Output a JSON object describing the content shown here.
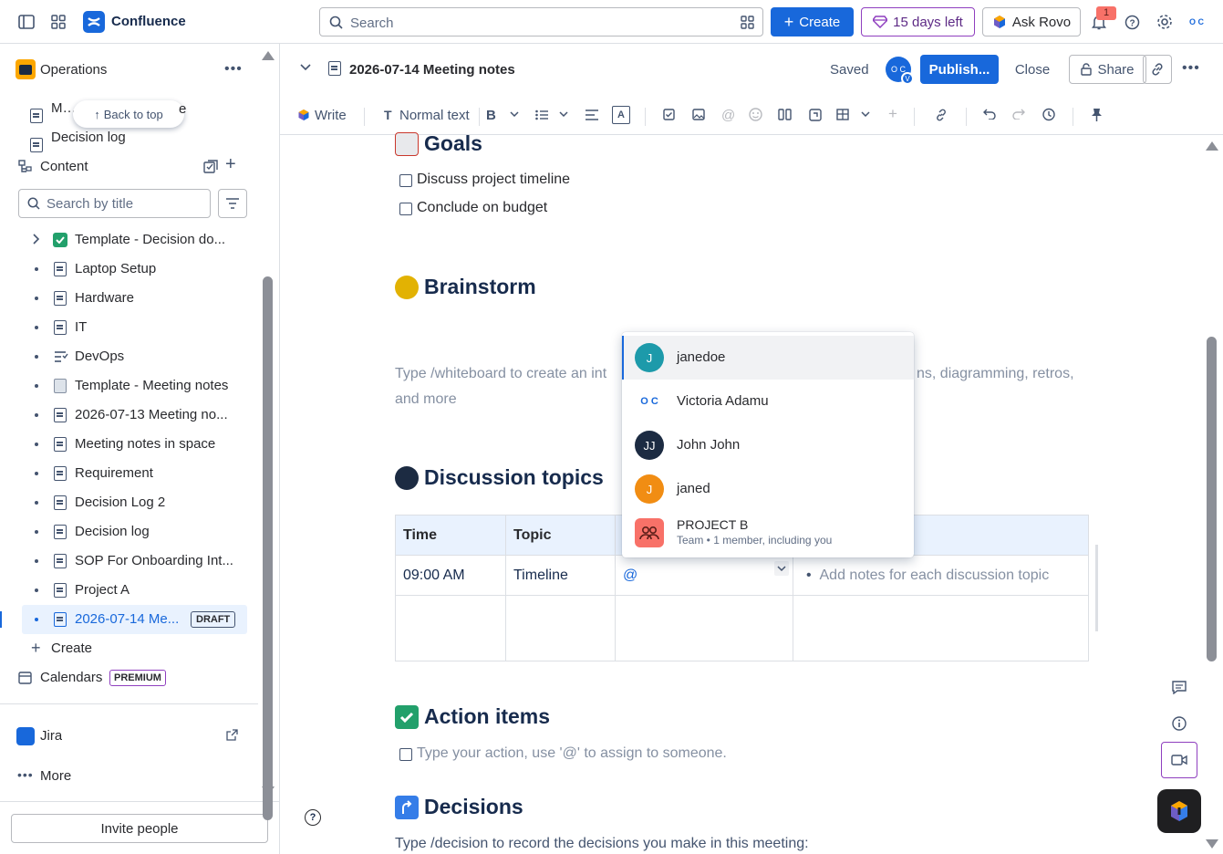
{
  "topbar": {
    "app_name": "Confluence",
    "search_placeholder": "Search",
    "create_label": "Create",
    "trial_label": "15 days left",
    "rovo_label": "Ask Rovo",
    "notification_count": "1",
    "avatar_text": "O C"
  },
  "sidebar": {
    "space_name": "Operations",
    "pinned": [
      "Meeting notes",
      "Decision log"
    ],
    "back_to_top": "Back to top",
    "content_label": "Content",
    "search_placeholder": "Search by title",
    "tree": [
      {
        "label": "Template - Decision do...",
        "icon": "check-emoji"
      },
      {
        "label": "Laptop Setup",
        "icon": "page"
      },
      {
        "label": "Hardware",
        "icon": "page"
      },
      {
        "label": "IT",
        "icon": "page"
      },
      {
        "label": "DevOps",
        "icon": "list"
      },
      {
        "label": "Template - Meeting notes",
        "icon": "notepad-emoji"
      },
      {
        "label": "2026-07-13 Meeting no...",
        "icon": "page"
      },
      {
        "label": "Meeting notes in space",
        "icon": "page"
      },
      {
        "label": "Requirement",
        "icon": "page"
      },
      {
        "label": "Decision Log 2",
        "icon": "page"
      },
      {
        "label": "Decision log",
        "icon": "page"
      },
      {
        "label": "SOP For Onboarding Int...",
        "icon": "page"
      },
      {
        "label": "Project A",
        "icon": "page"
      }
    ],
    "active_item": {
      "label": "2026-07-14 Me...",
      "badge": "DRAFT"
    },
    "create_label": "Create",
    "calendars_label": "Calendars",
    "premium_badge": "PREMIUM",
    "jira_label": "Jira",
    "more_label": "More",
    "invite_label": "Invite people"
  },
  "editor": {
    "page_title": "2026-07-14 Meeting notes",
    "saved_label": "Saved",
    "publish_label": "Publish...",
    "close_label": "Close",
    "share_label": "Share",
    "toolbar": {
      "write_label": "Write",
      "text_style": "Normal text"
    }
  },
  "doc": {
    "goals_heading": "Goals",
    "goals": [
      "Discuss project timeline",
      "Conclude on budget"
    ],
    "brainstorm_heading": "Brainstorm",
    "whiteboard_line1": "Type /whiteboard to create an int",
    "whiteboard_line1_end": "ns, diagramming, retros,",
    "whiteboard_line2": "and more",
    "discussion_heading": "Discussion topics",
    "table": {
      "headers": [
        "Time",
        "Topic"
      ],
      "row": {
        "time": "09:00 AM",
        "topic": "Timeline",
        "mention": "@",
        "notes_placeholder": "Add notes for each discussion topic"
      }
    },
    "action_heading": "Action items",
    "action_placeholder": "Type your action, use '@' to assign to someone.",
    "decisions_heading": "Decisions",
    "decisions_placeholder": "Type /decision to record the decisions you make in this meeting:"
  },
  "mention_popup": {
    "items": [
      {
        "name": "janedoe",
        "initial": "J",
        "color": "#1d9aaa"
      },
      {
        "name": "Victoria Adamu",
        "initial": "O C",
        "color": "#ffffff"
      },
      {
        "name": "John John",
        "initial": "JJ",
        "color": "#1c2b42"
      },
      {
        "name": "janed",
        "initial": "J",
        "color": "#f18d13"
      }
    ],
    "team": {
      "name": "PROJECT B",
      "sub": "Team • 1 member, including you"
    }
  }
}
